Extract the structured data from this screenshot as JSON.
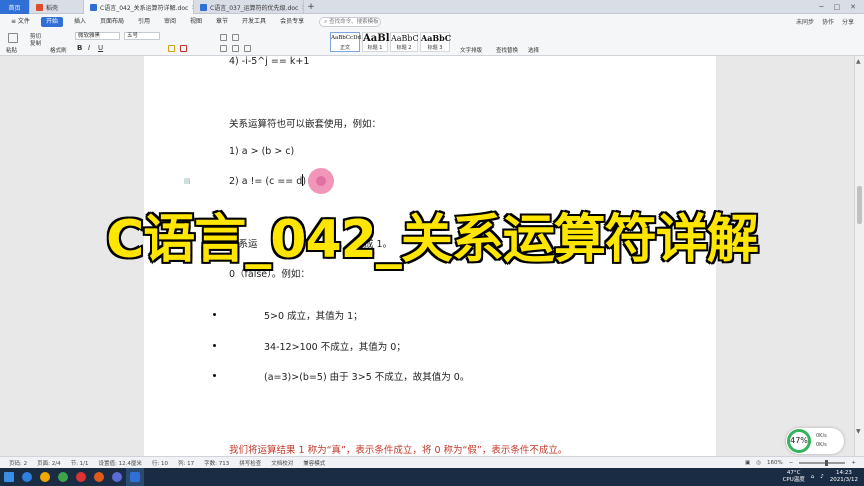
{
  "tabs": {
    "home": "首页",
    "shell": "稻壳",
    "doc1": "C语言_042_关系运算符详解.doc",
    "doc2": "C语言_037_运算符的优先级.doc",
    "add": "+"
  },
  "menu": {
    "file": "≡ 文件",
    "start": "开始",
    "items": [
      "插入",
      "页面布局",
      "引用",
      "审阅",
      "视图",
      "章节",
      "开发工具",
      "会员专享"
    ],
    "search_placeholder": "查找命令、搜索模板",
    "right": [
      "未同步",
      "协作",
      "分享"
    ]
  },
  "ribbon": {
    "paste": "粘贴",
    "cut": "剪切",
    "copy": "复制",
    "format_painter": "格式刷",
    "font_name": "微软雅黑",
    "font_size": "五号",
    "bold": "B",
    "italic": "I",
    "underline": "U",
    "styles": [
      {
        "sample": "AaBbCcDd",
        "label": "正文"
      },
      {
        "sample": "AaBl",
        "label": "标题 1"
      },
      {
        "sample": "AaBbC",
        "label": "标题 2"
      },
      {
        "sample": "AaBbC",
        "label": "标题 3"
      }
    ],
    "text_layout": "文字排版",
    "find_replace": "查找替换",
    "select": "选择"
  },
  "document": {
    "line_top": "4) -i-5^j == k+1",
    "line_nested_intro": "关系运算符也可以嵌套使用，例如：",
    "line_ex1": "1) a > (b > c)",
    "line_ex2": "2) a != (c == d)",
    "line_partial_left": "关系运",
    "line_partial_right": "成 1。",
    "line_false": "0（false）。例如：",
    "bullets": [
      "5>0  成立，其值为 1；",
      "34-12>100  不成立，其值为  0；",
      "(a=3)>(b=5)  由于 3>5 不成立，故其值为 0。"
    ],
    "red_note": "我们将运算结果  1  称为“真”，表示条件成立，将  0  称为“假”，表示条件不成立。"
  },
  "banner_title": "C语言_042_关系运算符详解",
  "net_widget": {
    "percent": "47%",
    "up": "0K/s",
    "down": "0K/s"
  },
  "statusbar": {
    "page": "页码: 2",
    "pages": "页面: 2/4",
    "section": "节: 1/1",
    "position": "设置值: 12.4厘米",
    "row": "行: 10",
    "col": "列: 17",
    "words": "字数: 713",
    "spellcheck": "拼写检查",
    "doc_check": "文档校对",
    "compat": "兼容模式",
    "zoom": "160%"
  },
  "tray": {
    "temp": "47°C",
    "cpu": "CPU温度",
    "time": "14:23",
    "date": "2021/3/12"
  },
  "colors": {
    "accent": "#2f6fd6",
    "banner_fill": "#ffe600",
    "red_text": "#c0392b",
    "net_ring": "#33b45a"
  }
}
